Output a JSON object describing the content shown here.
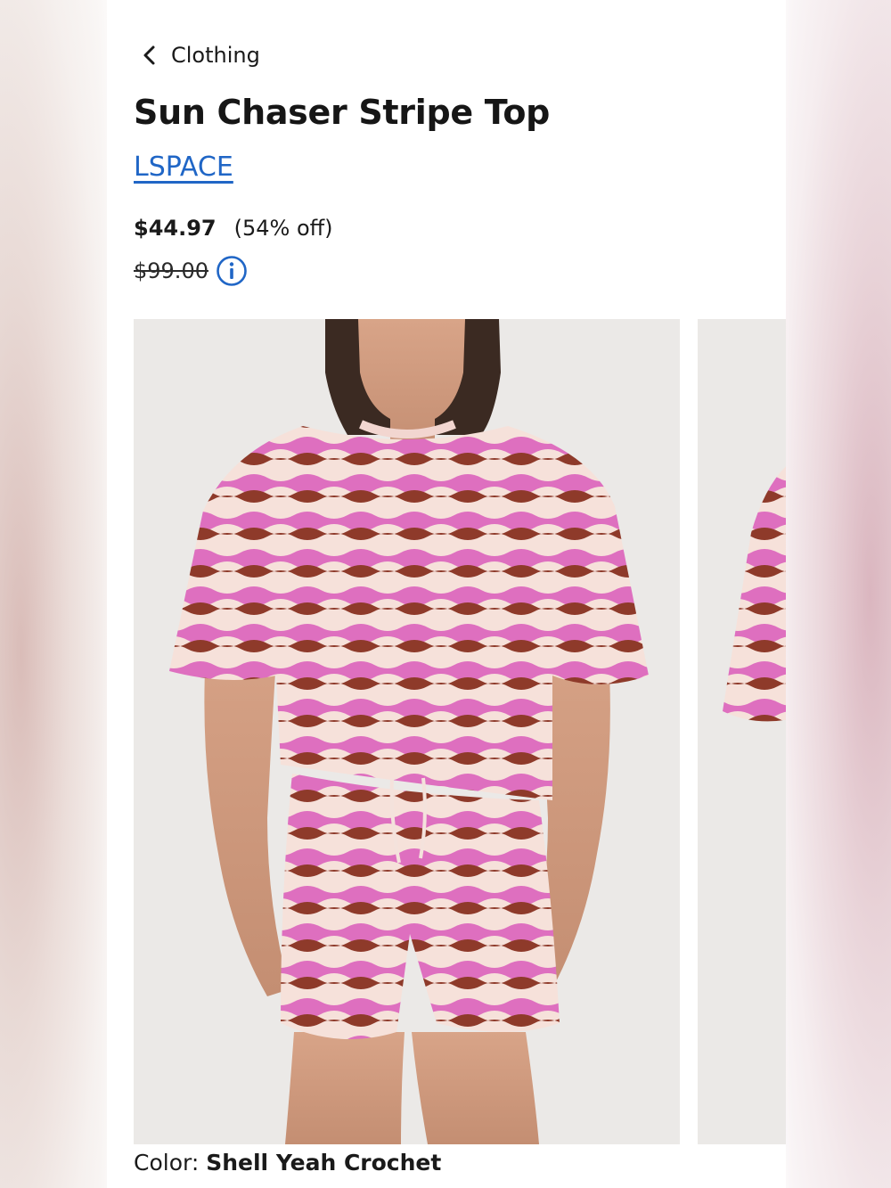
{
  "breadcrumb": {
    "label": "Clothing"
  },
  "product": {
    "title": "Sun Chaser Stripe Top",
    "brand": "LSPACE",
    "sale_price": "$44.97",
    "discount": "(54% off)",
    "original_price": "$99.00",
    "color_label": "Color:",
    "color_value": "Shell Yeah Crochet"
  },
  "gallery": {
    "images": [
      {
        "alt": "Model wearing pink, cream and brown wavy striped crochet top with matching shorts"
      },
      {
        "alt": "Partial view of next product image"
      }
    ]
  },
  "colors": {
    "link": "#2066c6",
    "stripe_pink": "#de6fbf",
    "stripe_brown": "#8e3a2a",
    "stripe_cream": "#f6e1da"
  }
}
